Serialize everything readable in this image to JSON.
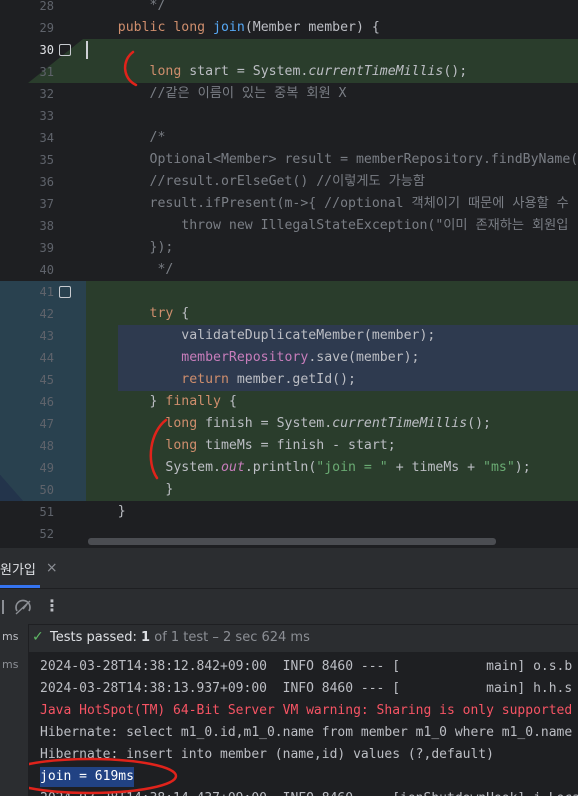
{
  "editor": {
    "lines": [
      {
        "n": "28",
        "segs": [
          {
            "t": "        */",
            "c": "cm"
          }
        ]
      },
      {
        "n": "29",
        "segs": [
          {
            "t": "    ",
            "c": ""
          },
          {
            "t": "public long ",
            "c": "kw"
          },
          {
            "t": "join",
            "c": "fn"
          },
          {
            "t": "(Member member) {",
            "c": ""
          }
        ]
      },
      {
        "n": "30",
        "segs": []
      },
      {
        "n": "31",
        "segs": [
          {
            "t": "        ",
            "c": ""
          },
          {
            "t": "long ",
            "c": "kw"
          },
          {
            "t": "start = System.",
            "c": ""
          },
          {
            "t": "currentTimeMillis",
            "c": "it"
          },
          {
            "t": "();",
            "c": ""
          }
        ]
      },
      {
        "n": "32",
        "segs": [
          {
            "t": "        //같은 이름이 있는 중복 회원 X",
            "c": "cm"
          }
        ]
      },
      {
        "n": "33",
        "segs": []
      },
      {
        "n": "34",
        "segs": [
          {
            "t": "        /*",
            "c": "cm"
          }
        ]
      },
      {
        "n": "35",
        "segs": [
          {
            "t": "        Optional<Member> result = memberRepository.findByName(",
            "c": "cm"
          }
        ]
      },
      {
        "n": "36",
        "segs": [
          {
            "t": "        //result.orElseGet() //이렇게도 가능함",
            "c": "cm"
          }
        ]
      },
      {
        "n": "37",
        "segs": [
          {
            "t": "        result.ifPresent(m->{ //optional 객체이기 때문에 사용할 수",
            "c": "cm"
          }
        ]
      },
      {
        "n": "38",
        "segs": [
          {
            "t": "            throw new IllegalStateException(\"이미 존재하는 회원입",
            "c": "cm"
          }
        ]
      },
      {
        "n": "39",
        "segs": [
          {
            "t": "        });",
            "c": "cm"
          }
        ]
      },
      {
        "n": "40",
        "segs": [
          {
            "t": "         */",
            "c": "cm"
          }
        ]
      },
      {
        "n": "41",
        "segs": []
      },
      {
        "n": "42",
        "segs": [
          {
            "t": "        ",
            "c": ""
          },
          {
            "t": "try ",
            "c": "kw"
          },
          {
            "t": "{",
            "c": ""
          }
        ]
      },
      {
        "n": "43",
        "segs": [
          {
            "t": "            validateDuplicateMember(member);",
            "c": ""
          }
        ]
      },
      {
        "n": "44",
        "segs": [
          {
            "t": "            ",
            "c": ""
          },
          {
            "t": "memberRepository",
            "c": "fld"
          },
          {
            "t": ".save(member);",
            "c": ""
          }
        ]
      },
      {
        "n": "45",
        "segs": [
          {
            "t": "            ",
            "c": ""
          },
          {
            "t": "return ",
            "c": "kw"
          },
          {
            "t": "member.getId();",
            "c": ""
          }
        ]
      },
      {
        "n": "46",
        "segs": [
          {
            "t": "        } ",
            "c": ""
          },
          {
            "t": "finally ",
            "c": "kw"
          },
          {
            "t": "{",
            "c": ""
          }
        ]
      },
      {
        "n": "47",
        "segs": [
          {
            "t": "          ",
            "c": ""
          },
          {
            "t": "long ",
            "c": "kw"
          },
          {
            "t": "finish = System.",
            "c": ""
          },
          {
            "t": "currentTimeMillis",
            "c": "it"
          },
          {
            "t": "();",
            "c": ""
          }
        ]
      },
      {
        "n": "48",
        "segs": [
          {
            "t": "          ",
            "c": ""
          },
          {
            "t": "long ",
            "c": "kw"
          },
          {
            "t": "timeMs = finish - start;",
            "c": ""
          }
        ]
      },
      {
        "n": "49",
        "segs": [
          {
            "t": "          System.",
            "c": ""
          },
          {
            "t": "out",
            "c": "ital-fld"
          },
          {
            "t": ".println(",
            "c": ""
          },
          {
            "t": "\"join = \"",
            "c": "st"
          },
          {
            "t": " + timeMs + ",
            "c": ""
          },
          {
            "t": "\"ms\"",
            "c": "st"
          },
          {
            "t": ");",
            "c": ""
          }
        ]
      },
      {
        "n": "50",
        "segs": [
          {
            "t": "          }",
            "c": ""
          }
        ]
      },
      {
        "n": "51",
        "segs": [
          {
            "t": "    }",
            "c": ""
          }
        ]
      },
      {
        "n": "52",
        "segs": []
      }
    ]
  },
  "run": {
    "tab_label": "원가입",
    "close_glyph": "×",
    "more_glyph": "⋮",
    "side_label_1": "ms",
    "side_label_2": "ms",
    "status": {
      "check_glyph": "✓",
      "passed": "Tests passed:",
      "count": "1",
      "rest": "of 1 test – 2 sec 624 ms"
    },
    "console": [
      {
        "t": "2024-03-28T14:38:12.842+09:00  INFO 8460 --- [           main] o.s.b",
        "c": "#bcbec4"
      },
      {
        "t": "2024-03-28T14:38:13.937+09:00  INFO 8460 --- [           main] h.h.s",
        "c": "#bcbec4"
      },
      {
        "t": "Java HotSpot(TM) 64-Bit Server VM warning: Sharing is only supported",
        "c": "#f75464"
      },
      {
        "t": "Hibernate: select m1_0.id,m1_0.name from member m1_0 where m1_0.name",
        "c": "#bcbec4"
      },
      {
        "t": "Hibernate: insert into member (name,id) values (?,default)",
        "c": "#bcbec4"
      },
      {
        "t": "join = 619ms",
        "c": "#bcbec4",
        "sel": true
      },
      {
        "t": "2024-03-28T14:38:14.437+09:00  INFO 8460 --- [ionShutdownHook] j.LocalC",
        "c": "#bcbec4"
      }
    ]
  },
  "colors": {
    "changed_bg": "#2a3d2c",
    "selection_bg": "#214283",
    "annotation_red": "#e0231b"
  }
}
